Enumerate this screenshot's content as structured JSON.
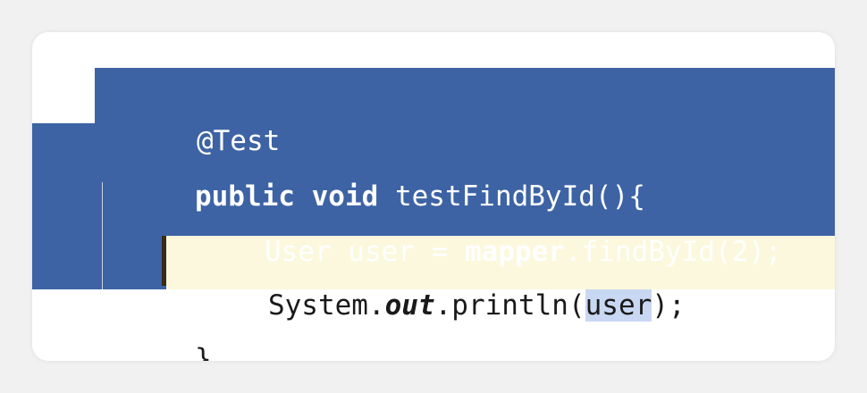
{
  "code": {
    "line1": "@Test",
    "line2_kw": "public void",
    "line2_rest": " testFindById(){",
    "line3_a": "User user = ",
    "line3_kw": "mapper",
    "line3_b": ".findById(2);",
    "line4_a": "System.",
    "line4_it": "out",
    "line4_b": ".println(",
    "line4_hl": "user",
    "line4_c": ");",
    "line5": "}"
  },
  "colors": {
    "selection": "#3d63a4",
    "caret_line": "#fbf8dd",
    "identifier_highlight": "#c9d8f2"
  }
}
